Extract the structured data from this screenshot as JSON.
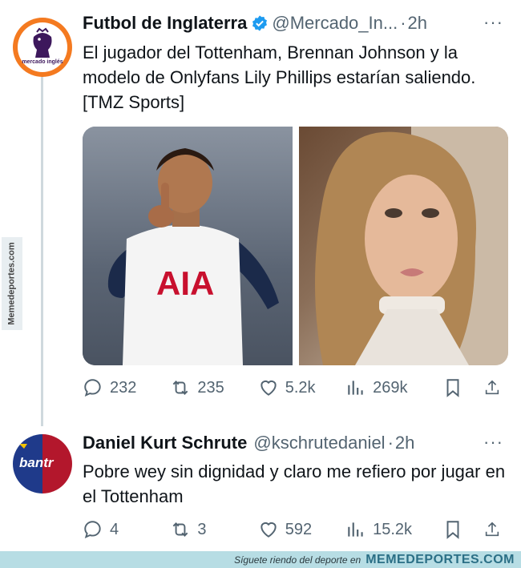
{
  "tweet1": {
    "name": "Futbol de Inglaterra",
    "handle": "@Mercado_In...",
    "time": "2h",
    "text": "El jugador del Tottenham, Brennan Johnson y la modelo de Onlyfans Lily Phillips estarían saliendo. [TMZ Sports]",
    "avatar_text": "mercado inglés",
    "jersey_text": "AIA",
    "stats": {
      "replies": "232",
      "retweets": "235",
      "likes": "5.2k",
      "views": "269k"
    }
  },
  "tweet2": {
    "name": "Daniel Kurt Schrute",
    "handle": "@kschrutedaniel",
    "time": "2h",
    "text": "Pobre wey sin dignidad y claro me refiero por jugar en el Tottenham",
    "avatar_text": "bantr",
    "stats": {
      "replies": "4",
      "retweets": "3",
      "likes": "592",
      "views": "15.2k"
    }
  },
  "watermark": {
    "side": "Memedeportes.com",
    "footer_text": "Síguete riendo del deporte en",
    "footer_brand": "MEMEDEPORTES.COM"
  },
  "colors": {
    "accent": "#1d9bf0",
    "muted": "#536471",
    "footer_bg": "#b7dde4"
  }
}
